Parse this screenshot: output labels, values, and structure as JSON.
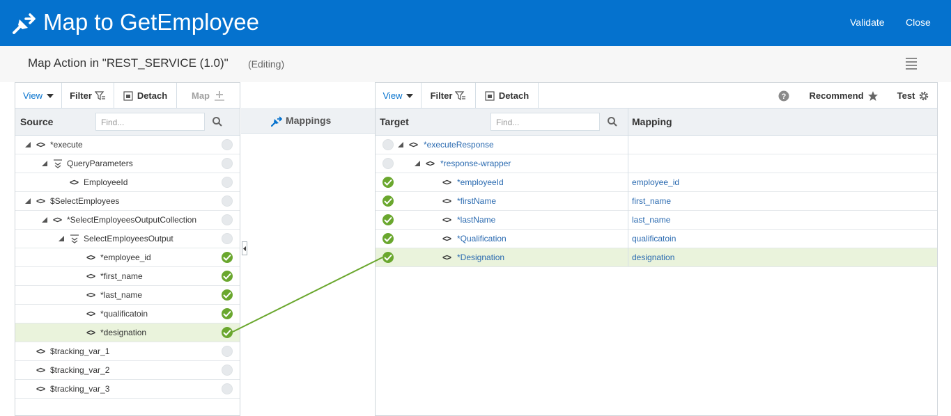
{
  "header": {
    "title": "Map to GetEmployee",
    "validate_label": "Validate",
    "close_label": "Close",
    "icon": "mapper-icon",
    "bg_color": "#0572ce"
  },
  "subheader": {
    "title": "Map Action in \"REST_SERVICE (1.0)\"",
    "status": "(Editing)",
    "menu_icon": "hamburger-icon"
  },
  "source": {
    "toolbar": {
      "view": "View",
      "filter": "Filter",
      "detach": "Detach",
      "map": "Map"
    },
    "column_label": "Source",
    "find_placeholder": "Find...",
    "rows": [
      {
        "label": "*execute",
        "mapped": false
      },
      {
        "label": "QueryParameters",
        "mapped": false
      },
      {
        "label": "EmployeeId",
        "mapped": false
      },
      {
        "label": "$SelectEmployees",
        "mapped": false
      },
      {
        "label": "*SelectEmployeesOutputCollection",
        "mapped": false
      },
      {
        "label": "SelectEmployeesOutput",
        "mapped": false
      },
      {
        "label": "*employee_id",
        "mapped": true
      },
      {
        "label": "*first_name",
        "mapped": true
      },
      {
        "label": "*last_name",
        "mapped": true
      },
      {
        "label": "*qualificatoin",
        "mapped": true
      },
      {
        "label": "*designation",
        "mapped": true,
        "selected": true
      },
      {
        "label": "$tracking_var_1",
        "mapped": false
      },
      {
        "label": "$tracking_var_2",
        "mapped": false
      },
      {
        "label": "$tracking_var_3",
        "mapped": false
      }
    ]
  },
  "mappings": {
    "label": "Mappings"
  },
  "target": {
    "toolbar": {
      "view": "View",
      "filter": "Filter",
      "detach": "Detach",
      "recommend": "Recommend",
      "test": "Test"
    },
    "column_label": "Target",
    "mapping_label": "Mapping",
    "find_placeholder": "Find...",
    "rows": [
      {
        "label": "*executeResponse",
        "mapping": "",
        "mapped": false
      },
      {
        "label": "*response-wrapper",
        "mapping": "",
        "mapped": false
      },
      {
        "label": "*employeeId",
        "mapping": "employee_id",
        "mapped": true
      },
      {
        "label": "*firstName",
        "mapping": "first_name",
        "mapped": true
      },
      {
        "label": "*lastName",
        "mapping": "last_name",
        "mapped": true
      },
      {
        "label": "*Qualification",
        "mapping": "qualificatoin",
        "mapped": true
      },
      {
        "label": "*Designation",
        "mapping": "designation",
        "mapped": true,
        "selected": true
      }
    ]
  },
  "colors": {
    "accent": "#0572ce",
    "mapped": "#6aa72e",
    "selected_row": "#eaf3dc",
    "link": "#2a6ab0"
  }
}
